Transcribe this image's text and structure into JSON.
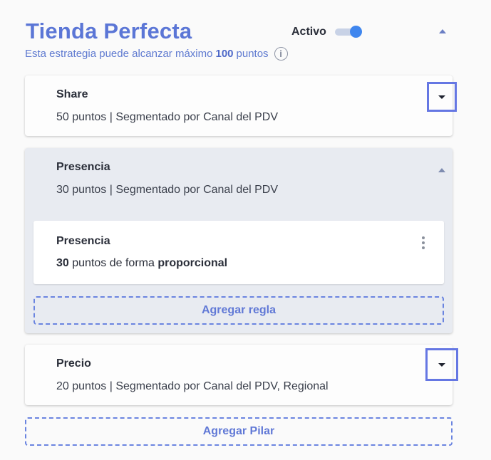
{
  "header": {
    "title": "Tienda Perfecta",
    "active_label": "Activo",
    "active": true,
    "subtitle_prefix": "Esta estrategia puede alcanzar máximo",
    "max_points": "100",
    "subtitle_suffix": "puntos",
    "info_icon": "info-circle-icon",
    "collapse_icon": "caret-up-icon"
  },
  "pillars": [
    {
      "title": "Share",
      "description": "50 puntos | Segmentado por Canal del PDV",
      "expanded": false,
      "toggle_icon": "caret-down-icon"
    },
    {
      "title": "Presencia",
      "description": "30 puntos | Segmentado por Canal del PDV",
      "expanded": true,
      "toggle_icon": "caret-up-icon",
      "rules": [
        {
          "title": "Presencia",
          "points": "30",
          "points_text": "puntos de forma",
          "mode": "proporcional",
          "menu_icon": "kebab-menu-icon"
        }
      ],
      "add_rule_label": "Agregar regla"
    },
    {
      "title": "Precio",
      "description": "20 puntos | Segmentado por Canal del PDV, Regional",
      "expanded": false,
      "toggle_icon": "caret-down-icon"
    }
  ],
  "add_pillar_label": "Agregar Pilar",
  "colors": {
    "accent": "#5b76d6",
    "toggle_on": "#3f86ee",
    "highlight_border": "#6577e3",
    "expanded_bg": "#e8ebf1"
  }
}
